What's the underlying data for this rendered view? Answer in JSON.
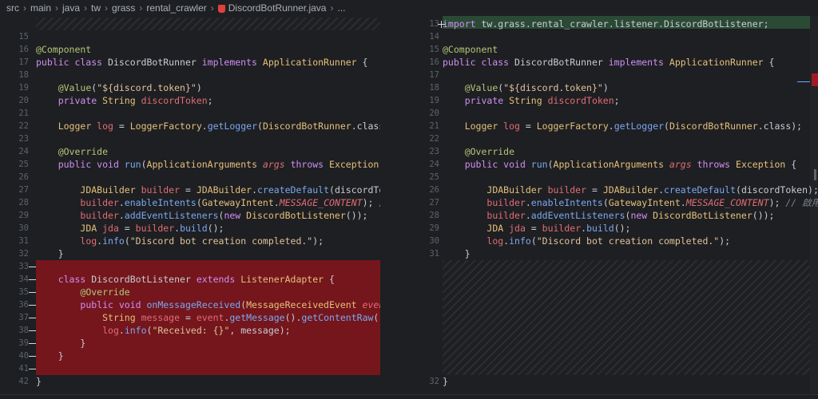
{
  "breadcrumb": [
    "src",
    "main",
    "java",
    "tw",
    "grass",
    "rental_crawler",
    "DiscordBotRunner.java",
    "..."
  ],
  "left": {
    "lines": [
      {
        "n": "",
        "code": [],
        "hatch": true
      },
      {
        "n": "15",
        "code": []
      },
      {
        "n": "16",
        "code": [
          [
            "an",
            "@Component"
          ]
        ]
      },
      {
        "n": "17",
        "code": [
          [
            "kw",
            "public class "
          ],
          [
            "",
            "DiscordBotRunner "
          ],
          [
            "kw",
            "implements "
          ],
          [
            "ty",
            "ApplicationRunner"
          ],
          [
            "",
            " {"
          ]
        ]
      },
      {
        "n": "18",
        "code": []
      },
      {
        "n": "19",
        "code": [
          [
            "",
            "    "
          ],
          [
            "an",
            "@Value"
          ],
          [
            "",
            "("
          ],
          [
            "str",
            "\"${discord.token}\""
          ],
          [
            "",
            ")"
          ]
        ]
      },
      {
        "n": "20",
        "code": [
          [
            "",
            "    "
          ],
          [
            "kw",
            "private "
          ],
          [
            "ty",
            "String "
          ],
          [
            "var",
            "discordToken"
          ],
          [
            "",
            ";"
          ]
        ]
      },
      {
        "n": "21",
        "code": []
      },
      {
        "n": "22",
        "code": [
          [
            "",
            "    "
          ],
          [
            "ty",
            "Logger "
          ],
          [
            "var",
            "log"
          ],
          [
            "",
            " = "
          ],
          [
            "ty",
            "LoggerFactory"
          ],
          [
            "",
            "."
          ],
          [
            "fn",
            "getLogger"
          ],
          [
            "",
            "("
          ],
          [
            "ty",
            "DiscordBotRunner"
          ],
          [
            "",
            ".class);"
          ]
        ]
      },
      {
        "n": "23",
        "code": []
      },
      {
        "n": "24",
        "code": [
          [
            "",
            "    "
          ],
          [
            "an",
            "@Override"
          ]
        ]
      },
      {
        "n": "25",
        "code": [
          [
            "",
            "    "
          ],
          [
            "kw",
            "public void "
          ],
          [
            "fn",
            "run"
          ],
          [
            "",
            "("
          ],
          [
            "ty",
            "ApplicationArguments "
          ],
          [
            "var it",
            "args"
          ],
          [
            "",
            " "
          ],
          [
            "kw",
            "throws "
          ],
          [
            "ty",
            "Exception"
          ],
          [
            "",
            " {"
          ]
        ]
      },
      {
        "n": "26",
        "code": []
      },
      {
        "n": "27",
        "code": [
          [
            "",
            "        "
          ],
          [
            "ty",
            "JDABuilder "
          ],
          [
            "var",
            "builder"
          ],
          [
            "",
            " = "
          ],
          [
            "ty",
            "JDABuilder"
          ],
          [
            "",
            "."
          ],
          [
            "fn",
            "createDefault"
          ],
          [
            "",
            "(discordToken"
          ]
        ]
      },
      {
        "n": "28",
        "code": [
          [
            "",
            "        "
          ],
          [
            "var",
            "builder"
          ],
          [
            "",
            "."
          ],
          [
            "fn",
            "enableIntents"
          ],
          [
            "",
            "("
          ],
          [
            "ty",
            "GatewayIntent"
          ],
          [
            "",
            "."
          ],
          [
            "var it",
            "MESSAGE_CONTENT"
          ],
          [
            "",
            "); "
          ],
          [
            "cm",
            "// 啟"
          ]
        ]
      },
      {
        "n": "29",
        "code": [
          [
            "",
            "        "
          ],
          [
            "var",
            "builder"
          ],
          [
            "",
            "."
          ],
          [
            "fn",
            "addEventListeners"
          ],
          [
            "",
            "("
          ],
          [
            "kw",
            "new "
          ],
          [
            "ty",
            "DiscordBotListener"
          ],
          [
            "",
            "());"
          ]
        ]
      },
      {
        "n": "30",
        "code": [
          [
            "",
            "        "
          ],
          [
            "ty",
            "JDA "
          ],
          [
            "var",
            "jda"
          ],
          [
            "",
            " = "
          ],
          [
            "var",
            "builder"
          ],
          [
            "",
            "."
          ],
          [
            "fn",
            "build"
          ],
          [
            "",
            "();"
          ]
        ]
      },
      {
        "n": "31",
        "code": [
          [
            "",
            "        "
          ],
          [
            "var",
            "log"
          ],
          [
            "",
            "."
          ],
          [
            "fn",
            "info"
          ],
          [
            "",
            "("
          ],
          [
            "str",
            "\"Discord bot creation completed.\""
          ],
          [
            "",
            ");"
          ]
        ]
      },
      {
        "n": "32",
        "code": [
          [
            "",
            "    }"
          ]
        ]
      },
      {
        "n": "33",
        "code": [],
        "chg": true
      },
      {
        "n": "34",
        "code": [
          [
            "",
            "    "
          ],
          [
            "kw",
            "class "
          ],
          [
            "",
            "DiscordBotListener "
          ],
          [
            "kw",
            "extends "
          ],
          [
            "ty",
            "ListenerAdapter"
          ],
          [
            "",
            " {"
          ]
        ],
        "chg": true
      },
      {
        "n": "35",
        "code": [
          [
            "",
            "        "
          ],
          [
            "an",
            "@Override"
          ]
        ],
        "chg": true
      },
      {
        "n": "36",
        "code": [
          [
            "",
            "        "
          ],
          [
            "kw",
            "public void "
          ],
          [
            "fn",
            "onMessageReceived"
          ],
          [
            "",
            "("
          ],
          [
            "ty",
            "MessageReceivedEvent "
          ],
          [
            "var it",
            "event"
          ],
          [
            "",
            ")"
          ]
        ],
        "chg": true
      },
      {
        "n": "37",
        "code": [
          [
            "",
            "            "
          ],
          [
            "ty",
            "String "
          ],
          [
            "var",
            "message"
          ],
          [
            "",
            " = "
          ],
          [
            "var",
            "event"
          ],
          [
            "",
            "."
          ],
          [
            "fn",
            "getMessage"
          ],
          [
            "",
            "()."
          ],
          [
            "fn",
            "getContentRaw"
          ],
          [
            "",
            "();"
          ]
        ],
        "chg": true
      },
      {
        "n": "38",
        "code": [
          [
            "",
            "            "
          ],
          [
            "var",
            "log"
          ],
          [
            "",
            "."
          ],
          [
            "fn",
            "info"
          ],
          [
            "",
            "("
          ],
          [
            "str",
            "\"Received: {}\""
          ],
          [
            "",
            ", message);"
          ]
        ],
        "chg": true
      },
      {
        "n": "39",
        "code": [
          [
            "",
            "        }"
          ]
        ],
        "chg": true
      },
      {
        "n": "40",
        "code": [
          [
            "",
            "    }"
          ]
        ],
        "chg": true
      },
      {
        "n": "41",
        "code": [],
        "chg": true
      },
      {
        "n": "42",
        "code": [
          [
            "",
            "}"
          ]
        ]
      }
    ]
  },
  "right": {
    "lines": [
      {
        "n": "13",
        "code": [
          [
            "kw",
            "import "
          ],
          [
            "",
            "tw.grass.rental_crawler.listener.DiscordBotListener;"
          ]
        ],
        "plus": true
      },
      {
        "n": "14",
        "code": []
      },
      {
        "n": "15",
        "code": [
          [
            "an",
            "@Component"
          ]
        ]
      },
      {
        "n": "16",
        "code": [
          [
            "kw",
            "public class "
          ],
          [
            "",
            "DiscordBotRunner "
          ],
          [
            "kw",
            "implements "
          ],
          [
            "ty",
            "ApplicationRunner"
          ],
          [
            "",
            " {"
          ]
        ]
      },
      {
        "n": "17",
        "code": []
      },
      {
        "n": "18",
        "code": [
          [
            "",
            "    "
          ],
          [
            "an",
            "@Value"
          ],
          [
            "",
            "("
          ],
          [
            "str",
            "\"${discord.token}\""
          ],
          [
            "",
            ")"
          ]
        ]
      },
      {
        "n": "19",
        "code": [
          [
            "",
            "    "
          ],
          [
            "kw",
            "private "
          ],
          [
            "ty",
            "String "
          ],
          [
            "var",
            "discordToken"
          ],
          [
            "",
            ";"
          ]
        ]
      },
      {
        "n": "20",
        "code": []
      },
      {
        "n": "21",
        "code": [
          [
            "",
            "    "
          ],
          [
            "ty",
            "Logger "
          ],
          [
            "var",
            "log"
          ],
          [
            "",
            " = "
          ],
          [
            "ty",
            "LoggerFactory"
          ],
          [
            "",
            "."
          ],
          [
            "fn",
            "getLogger"
          ],
          [
            "",
            "("
          ],
          [
            "ty",
            "DiscordBotRunner"
          ],
          [
            "",
            ".class);"
          ]
        ]
      },
      {
        "n": "22",
        "code": []
      },
      {
        "n": "23",
        "code": [
          [
            "",
            "    "
          ],
          [
            "an",
            "@Override"
          ]
        ]
      },
      {
        "n": "24",
        "code": [
          [
            "",
            "    "
          ],
          [
            "kw",
            "public void "
          ],
          [
            "fn",
            "run"
          ],
          [
            "",
            "("
          ],
          [
            "ty",
            "ApplicationArguments "
          ],
          [
            "var it",
            "args"
          ],
          [
            "",
            " "
          ],
          [
            "kw",
            "throws "
          ],
          [
            "ty",
            "Exception"
          ],
          [
            "",
            " {"
          ]
        ]
      },
      {
        "n": "25",
        "code": []
      },
      {
        "n": "26",
        "code": [
          [
            "",
            "        "
          ],
          [
            "ty",
            "JDABuilder "
          ],
          [
            "var",
            "builder"
          ],
          [
            "",
            " = "
          ],
          [
            "ty",
            "JDABuilder"
          ],
          [
            "",
            "."
          ],
          [
            "fn",
            "createDefault"
          ],
          [
            "",
            "(discordToken);"
          ]
        ]
      },
      {
        "n": "27",
        "code": [
          [
            "",
            "        "
          ],
          [
            "var",
            "builder"
          ],
          [
            "",
            "."
          ],
          [
            "fn",
            "enableIntents"
          ],
          [
            "",
            "("
          ],
          [
            "ty",
            "GatewayIntent"
          ],
          [
            "",
            "."
          ],
          [
            "var it",
            "MESSAGE_CONTENT"
          ],
          [
            "",
            "); "
          ],
          [
            "cm",
            "// 啟用 M"
          ]
        ]
      },
      {
        "n": "28",
        "code": [
          [
            "",
            "        "
          ],
          [
            "var",
            "builder"
          ],
          [
            "",
            "."
          ],
          [
            "fn",
            "addEventListeners"
          ],
          [
            "",
            "("
          ],
          [
            "kw",
            "new "
          ],
          [
            "ty",
            "DiscordBotListener"
          ],
          [
            "",
            "());"
          ]
        ]
      },
      {
        "n": "29",
        "code": [
          [
            "",
            "        "
          ],
          [
            "ty",
            "JDA "
          ],
          [
            "var",
            "jda"
          ],
          [
            "",
            " = "
          ],
          [
            "var",
            "builder"
          ],
          [
            "",
            "."
          ],
          [
            "fn",
            "build"
          ],
          [
            "",
            "();"
          ]
        ]
      },
      {
        "n": "30",
        "code": [
          [
            "",
            "        "
          ],
          [
            "var",
            "log"
          ],
          [
            "",
            "."
          ],
          [
            "fn",
            "info"
          ],
          [
            "",
            "("
          ],
          [
            "str",
            "\"Discord bot creation completed.\""
          ],
          [
            "",
            ");"
          ]
        ]
      },
      {
        "n": "31",
        "code": [
          [
            "",
            "    }"
          ]
        ]
      },
      {
        "n": "32",
        "code": [
          [
            "",
            "}"
          ]
        ]
      }
    ]
  }
}
